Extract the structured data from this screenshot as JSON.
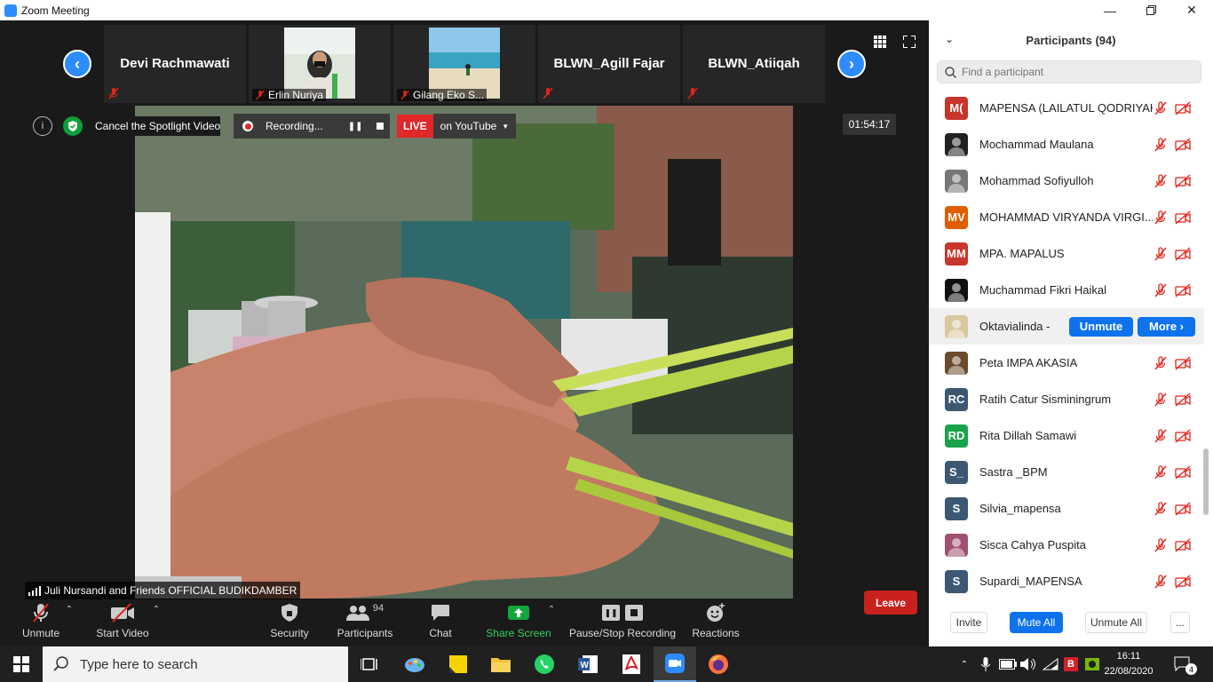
{
  "window": {
    "title": "Zoom Meeting"
  },
  "thumbnails": [
    {
      "name": "Devi Rachmawati",
      "show_name": true
    },
    {
      "name": "Erlin Nuriya",
      "show_name": false
    },
    {
      "name": "Gilang Eko S...",
      "show_name": false
    },
    {
      "name": "BLWN_Agill Fajar",
      "show_name": true
    },
    {
      "name": "BLWN_Atiiqah",
      "show_name": true
    }
  ],
  "banner": {
    "spotlight": "Cancel the Spotlight Video",
    "recording": "Recording...",
    "live": "LIVE",
    "live_target": "on YouTube"
  },
  "timer": "01:54:17",
  "speaker_label": "Juli Nursandi and Friends OFFICIAL BUDIKDAMBER",
  "toolbar": {
    "unmute": "Unmute",
    "start_video": "Start Video",
    "security": "Security",
    "participants": "Participants",
    "participants_count": "94",
    "chat": "Chat",
    "share_screen": "Share Screen",
    "pause_stop_recording": "Pause/Stop Recording",
    "reactions": "Reactions",
    "leave": "Leave"
  },
  "panel": {
    "title": "Participants (94)",
    "search_placeholder": "Find a participant",
    "participants": [
      {
        "name": "MAPENSA (LAILATUL QODRIYAH)",
        "initials": "M(",
        "color": "#c8352a",
        "avatar": "initials"
      },
      {
        "name": "Mochammad Maulana",
        "initials": "",
        "color": "#222222",
        "avatar": "photo-dark"
      },
      {
        "name": "Mohammad Sofiyulloh",
        "initials": "",
        "color": "#777777",
        "avatar": "photo"
      },
      {
        "name": "MOHAMMAD VIRYANDA VIRGI...",
        "initials": "MV",
        "color": "#e05d00",
        "avatar": "initials"
      },
      {
        "name": "MPA. MAPALUS",
        "initials": "MM",
        "color": "#c8352a",
        "avatar": "initials"
      },
      {
        "name": "Muchammad Fikri Haikal",
        "initials": "",
        "color": "#111111",
        "avatar": "photo-dark"
      },
      {
        "name": "Oktavialinda -",
        "initials": "",
        "color": "#d9c7a0",
        "avatar": "photo",
        "hover": true
      },
      {
        "name": "Peta IMPA AKASIA",
        "initials": "",
        "color": "#6b4a2d",
        "avatar": "photo"
      },
      {
        "name": "Ratih Catur Sisminingrum",
        "initials": "RC",
        "color": "#3c5873",
        "avatar": "initials"
      },
      {
        "name": "Rita Dillah Samawi",
        "initials": "RD",
        "color": "#1aa34a",
        "avatar": "initials"
      },
      {
        "name": "Sastra _BPM",
        "initials": "S_",
        "color": "#3c5873",
        "avatar": "initials"
      },
      {
        "name": "Silvia_mapensa",
        "initials": "S",
        "color": "#3c5873",
        "avatar": "initials"
      },
      {
        "name": "Sisca Cahya Puspita",
        "initials": "",
        "color": "#a05070",
        "avatar": "photo"
      },
      {
        "name": "Supardi_MAPENSA",
        "initials": "S",
        "color": "#3c5873",
        "avatar": "initials"
      }
    ],
    "hover_unmute": "Unmute",
    "hover_more": "More ›",
    "footer": {
      "invite": "Invite",
      "mute_all": "Mute All",
      "unmute_all": "Unmute All",
      "more": "..."
    }
  },
  "taskbar": {
    "search_placeholder": "Type here to search",
    "time": "16:11",
    "date": "22/08/2020",
    "notifications": "4"
  },
  "colors": {
    "zoom_blue": "#2d8cff",
    "live_red": "#e02828",
    "leave_red": "#c9211e",
    "share_green": "#0fa83b",
    "muted_red": "#e0241b"
  }
}
